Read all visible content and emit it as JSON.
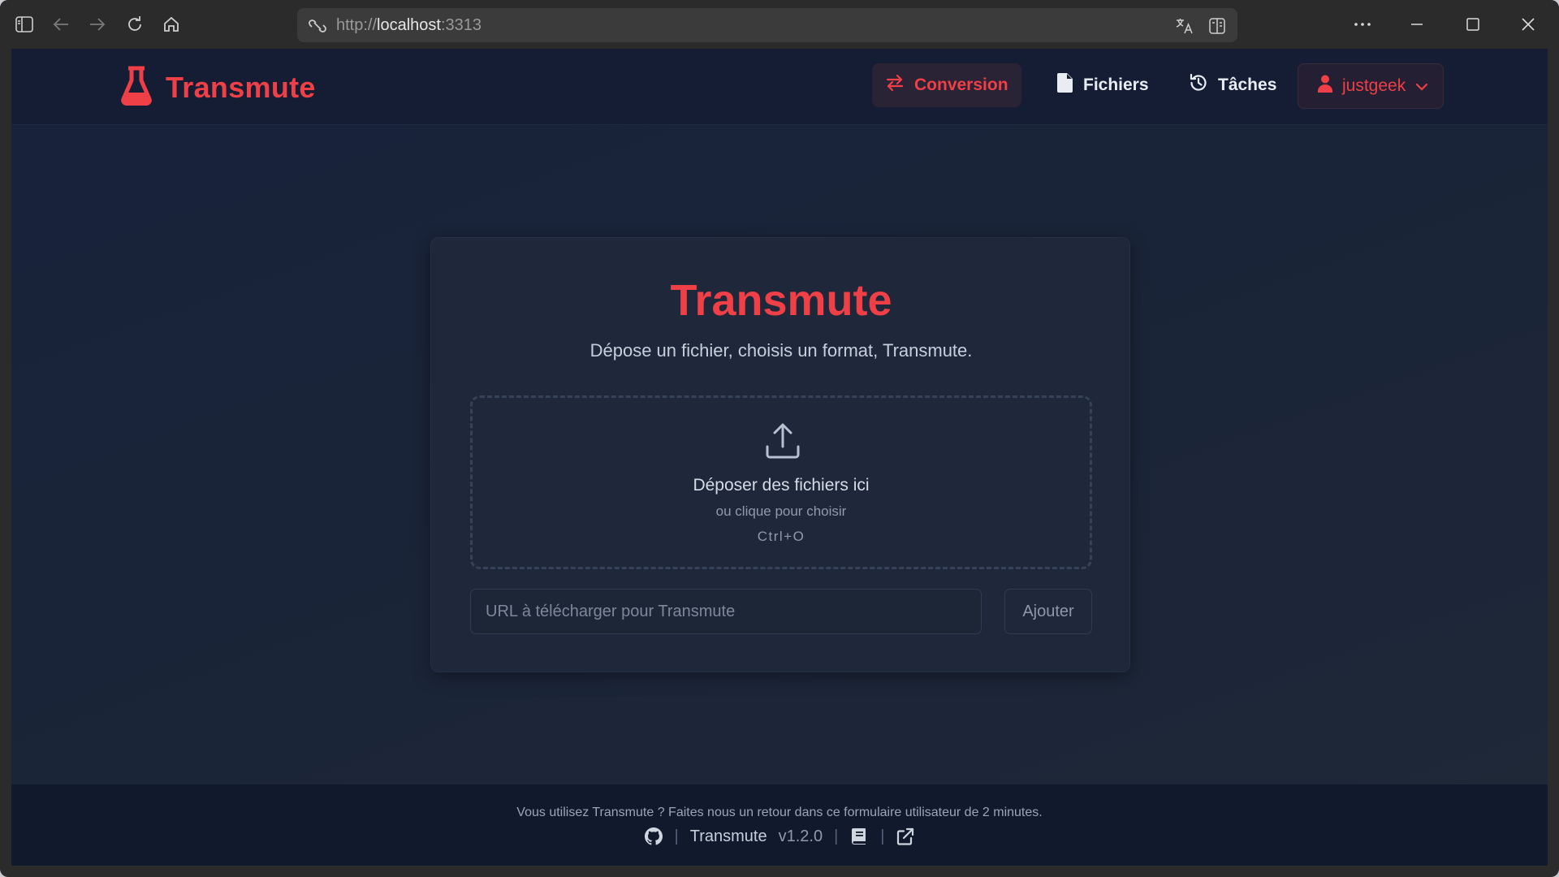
{
  "browser": {
    "url_scheme": "http://",
    "url_host": "localhost",
    "url_port": ":3313"
  },
  "brand": {
    "name": "Transmute"
  },
  "nav": {
    "items": [
      {
        "label": "Conversion",
        "icon": "swap-arrows-icon",
        "active": true
      },
      {
        "label": "Fichiers",
        "icon": "file-icon",
        "active": false
      },
      {
        "label": "Tâches",
        "icon": "history-icon",
        "active": false
      }
    ],
    "user": {
      "name": "justgeek",
      "icon": "user-icon"
    }
  },
  "card": {
    "title": "Transmute",
    "subtitle": "Dépose un fichier, choisis un format, Transmute.",
    "dropzone": {
      "title": "Déposer des fichiers ici",
      "hint": "ou clique pour choisir",
      "shortcut": "Ctrl+O"
    },
    "url_input": {
      "placeholder": "URL à télécharger pour Transmute",
      "value": ""
    },
    "add_button": "Ajouter"
  },
  "footer": {
    "message": "Vous utilisez Transmute ? Faites nous un retour dans ce formulaire utilisateur de 2 minutes.",
    "app_name": "Transmute",
    "version": "v1.2.0",
    "separator": "|"
  },
  "colors": {
    "accent": "#ef3f47",
    "background": "#1b2538",
    "card": "#1e283a",
    "nav": "#141d33"
  }
}
